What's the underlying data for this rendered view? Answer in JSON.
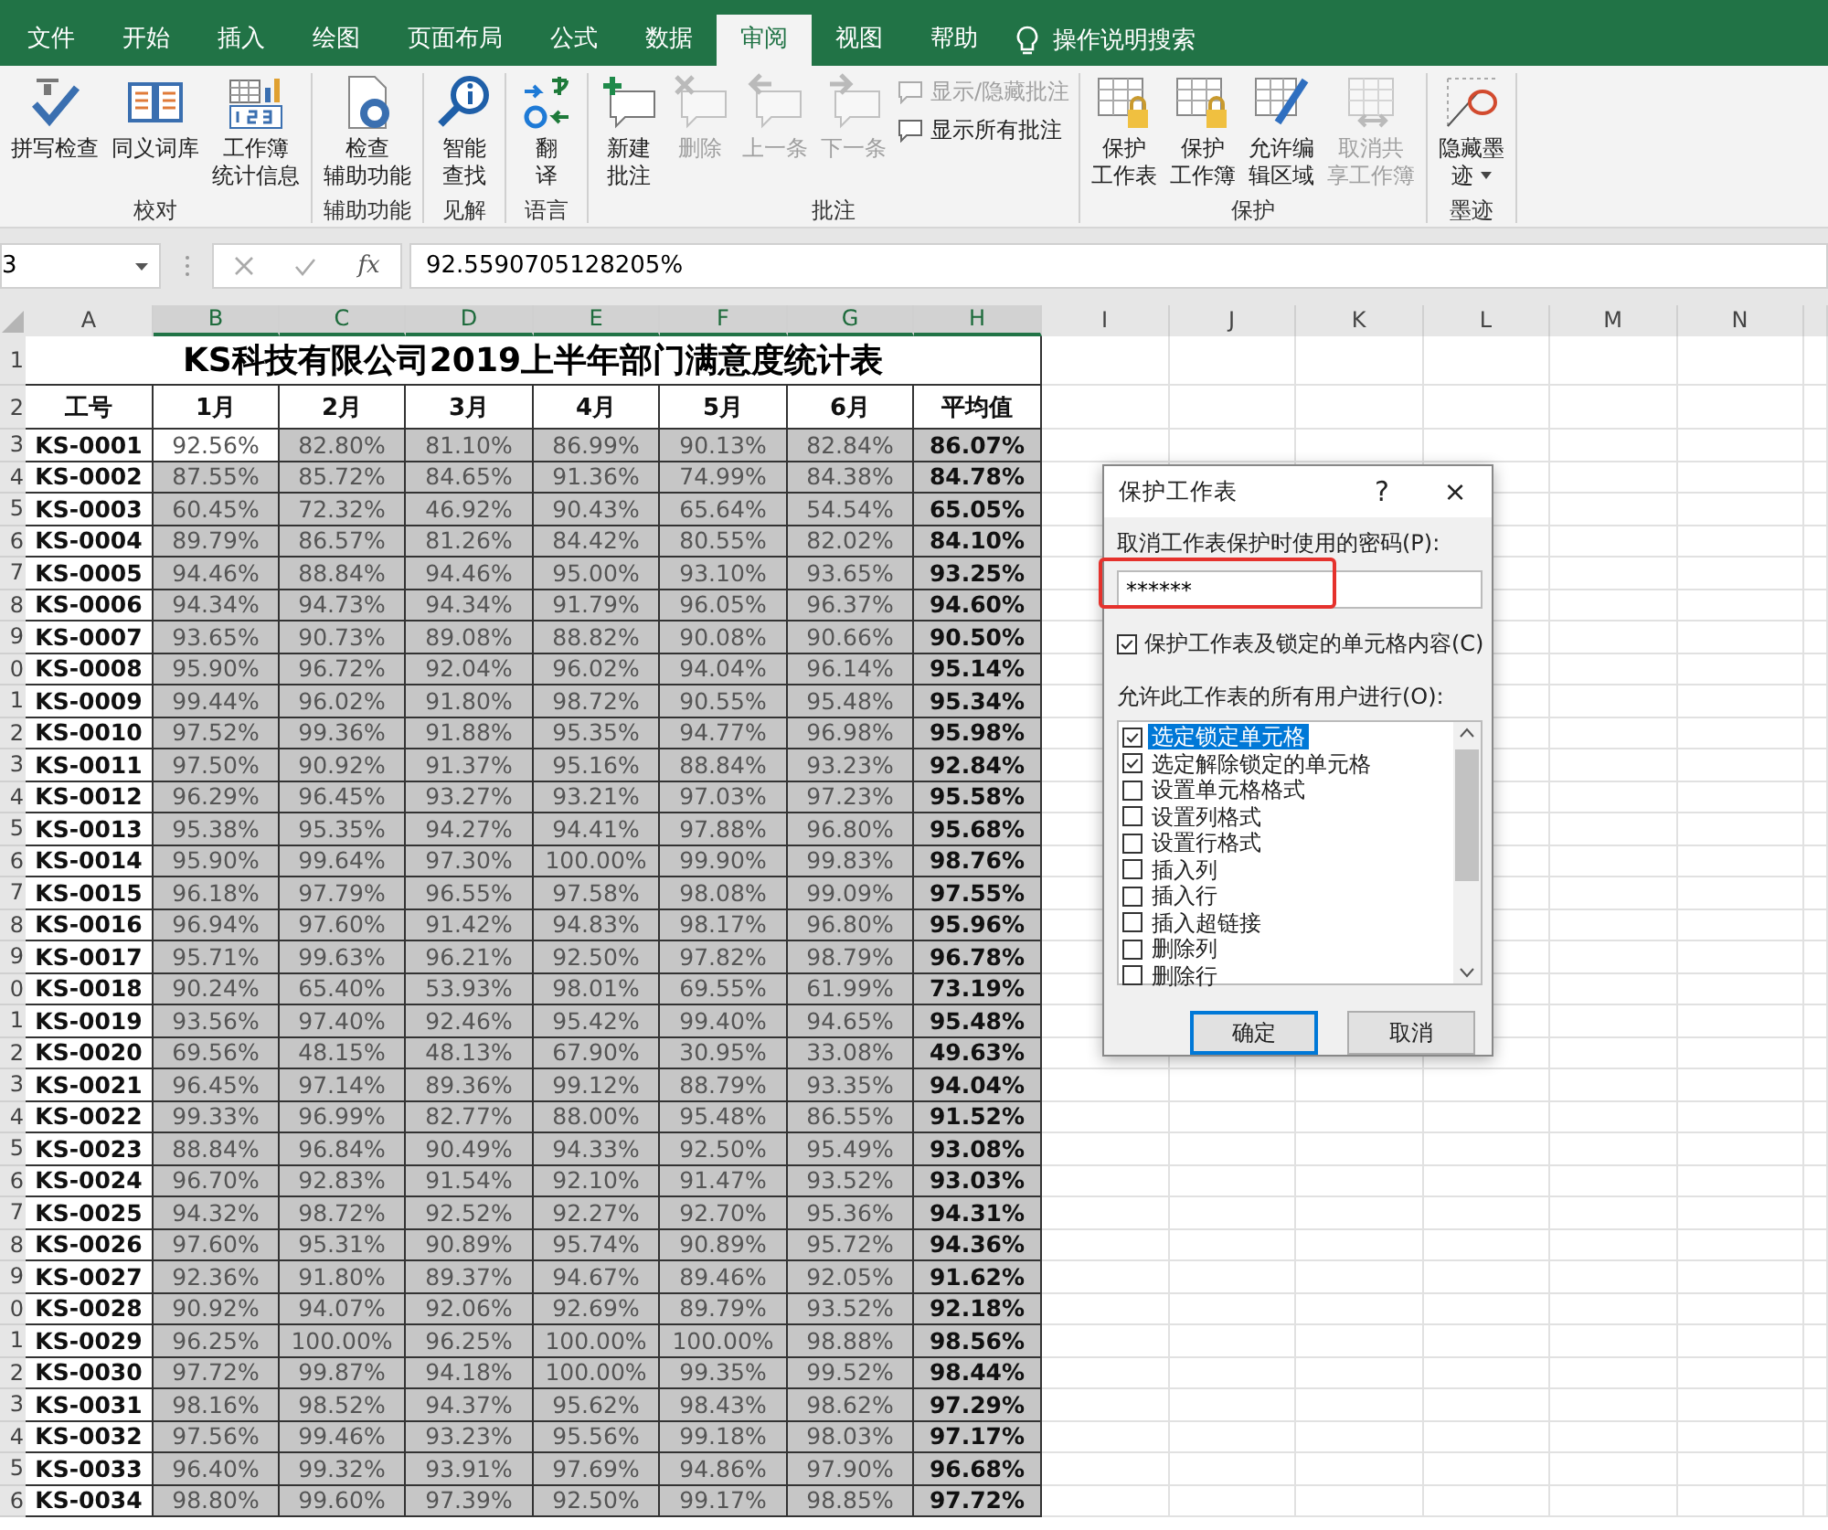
{
  "tabs": [
    {
      "label": "文件",
      "selected": false
    },
    {
      "label": "开始",
      "selected": false
    },
    {
      "label": "插入",
      "selected": false
    },
    {
      "label": "绘图",
      "selected": false
    },
    {
      "label": "页面布局",
      "selected": false
    },
    {
      "label": "公式",
      "selected": false
    },
    {
      "label": "数据",
      "selected": false
    },
    {
      "label": "审阅",
      "selected": true
    },
    {
      "label": "视图",
      "selected": false
    },
    {
      "label": "帮助",
      "selected": false
    }
  ],
  "search": {
    "label": "操作说明搜索"
  },
  "ribbon_groups": [
    {
      "label": "校对",
      "buttons": [
        {
          "lines": [
            "拼写检查"
          ],
          "disabled": false
        },
        {
          "lines": [
            "同义词库"
          ],
          "disabled": false
        },
        {
          "lines": [
            "工作簿",
            "统计信息"
          ],
          "disabled": false
        }
      ]
    },
    {
      "label": "辅助功能",
      "buttons": [
        {
          "lines": [
            "检查",
            "辅助功能"
          ],
          "disabled": false
        }
      ]
    },
    {
      "label": "见解",
      "buttons": [
        {
          "lines": [
            "智能",
            "查找"
          ],
          "disabled": false
        }
      ]
    },
    {
      "label": "语言",
      "buttons": [
        {
          "lines": [
            "翻",
            "译"
          ],
          "disabled": false
        }
      ]
    },
    {
      "label": "批注",
      "buttons": [
        {
          "lines": [
            "新建",
            "批注"
          ],
          "disabled": false
        },
        {
          "lines": [
            "删除"
          ],
          "disabled": true
        },
        {
          "lines": [
            "上一条"
          ],
          "disabled": true
        },
        {
          "lines": [
            "下一条"
          ],
          "disabled": true
        }
      ],
      "small_buttons": [
        {
          "label": "显示/隐藏批注",
          "disabled": true
        },
        {
          "label": "显示所有批注",
          "disabled": false
        }
      ]
    },
    {
      "label": "保护",
      "buttons": [
        {
          "lines": [
            "保护",
            "工作表"
          ],
          "disabled": false
        },
        {
          "lines": [
            "保护",
            "工作簿"
          ],
          "disabled": false
        },
        {
          "lines": [
            "允许编",
            "辑区域"
          ],
          "disabled": false
        },
        {
          "lines": [
            "取消共",
            "享工作簿"
          ],
          "disabled": true
        }
      ]
    },
    {
      "label": "墨迹",
      "buttons": [
        {
          "lines": [
            "隐藏墨",
            "迹"
          ],
          "disabled": false,
          "dropdown": true
        }
      ]
    }
  ],
  "formula_bar": {
    "name_box": "3",
    "function_label": "fx",
    "formula": "92.5590705128205%"
  },
  "sheet": {
    "columns": [
      {
        "label": "A",
        "selected": false
      },
      {
        "label": "B",
        "selected": true
      },
      {
        "label": "C",
        "selected": true
      },
      {
        "label": "D",
        "selected": true
      },
      {
        "label": "E",
        "selected": true
      },
      {
        "label": "F",
        "selected": true
      },
      {
        "label": "G",
        "selected": true
      },
      {
        "label": "H",
        "selected": true
      },
      {
        "label": "I",
        "selected": false
      },
      {
        "label": "J",
        "selected": false
      },
      {
        "label": "K",
        "selected": false
      },
      {
        "label": "L",
        "selected": false
      },
      {
        "label": "M",
        "selected": false
      },
      {
        "label": "N",
        "selected": false
      }
    ],
    "title_row": {
      "row": "1",
      "title": "KS科技有限公司2019上半年部门满意度统计表"
    },
    "header_row": {
      "row": "2",
      "cells": [
        "工号",
        "1月",
        "2月",
        "3月",
        "4月",
        "5月",
        "6月",
        "平均值"
      ]
    },
    "rows": [
      {
        "row": "3",
        "active": true,
        "cells": [
          "KS-0001",
          "92.56%",
          "82.80%",
          "81.10%",
          "86.99%",
          "90.13%",
          "82.84%",
          "86.07%"
        ]
      },
      {
        "row": "4",
        "active": false,
        "cells": [
          "KS-0002",
          "87.55%",
          "85.72%",
          "84.65%",
          "91.36%",
          "74.99%",
          "84.38%",
          "84.78%"
        ]
      },
      {
        "row": "5",
        "active": false,
        "cells": [
          "KS-0003",
          "60.45%",
          "72.32%",
          "46.92%",
          "90.43%",
          "65.64%",
          "54.54%",
          "65.05%"
        ]
      },
      {
        "row": "6",
        "active": false,
        "cells": [
          "KS-0004",
          "89.79%",
          "86.57%",
          "81.26%",
          "84.42%",
          "80.55%",
          "82.02%",
          "84.10%"
        ]
      },
      {
        "row": "7",
        "active": false,
        "cells": [
          "KS-0005",
          "94.46%",
          "88.84%",
          "94.46%",
          "95.00%",
          "93.10%",
          "93.65%",
          "93.25%"
        ]
      },
      {
        "row": "8",
        "active": false,
        "cells": [
          "KS-0006",
          "94.34%",
          "94.73%",
          "94.34%",
          "91.79%",
          "96.05%",
          "96.37%",
          "94.60%"
        ]
      },
      {
        "row": "9",
        "active": false,
        "cells": [
          "KS-0007",
          "93.65%",
          "90.73%",
          "89.08%",
          "88.82%",
          "90.08%",
          "90.66%",
          "90.50%"
        ]
      },
      {
        "row": "0",
        "active": false,
        "cells": [
          "KS-0008",
          "95.90%",
          "96.72%",
          "92.04%",
          "96.02%",
          "94.04%",
          "96.14%",
          "95.14%"
        ]
      },
      {
        "row": "1",
        "active": false,
        "cells": [
          "KS-0009",
          "99.44%",
          "96.02%",
          "91.80%",
          "98.72%",
          "90.55%",
          "95.48%",
          "95.34%"
        ]
      },
      {
        "row": "2",
        "active": false,
        "cells": [
          "KS-0010",
          "97.52%",
          "99.36%",
          "91.88%",
          "95.35%",
          "94.77%",
          "96.98%",
          "95.98%"
        ]
      },
      {
        "row": "3",
        "active": false,
        "cells": [
          "KS-0011",
          "97.50%",
          "90.92%",
          "91.37%",
          "95.16%",
          "88.84%",
          "93.23%",
          "92.84%"
        ]
      },
      {
        "row": "4",
        "active": false,
        "cells": [
          "KS-0012",
          "96.29%",
          "96.45%",
          "93.27%",
          "93.21%",
          "97.03%",
          "97.23%",
          "95.58%"
        ]
      },
      {
        "row": "5",
        "active": false,
        "cells": [
          "KS-0013",
          "95.38%",
          "95.35%",
          "94.27%",
          "94.41%",
          "97.88%",
          "96.80%",
          "95.68%"
        ]
      },
      {
        "row": "6",
        "active": false,
        "cells": [
          "KS-0014",
          "95.90%",
          "99.64%",
          "97.30%",
          "100.00%",
          "99.90%",
          "99.83%",
          "98.76%"
        ]
      },
      {
        "row": "7",
        "active": false,
        "cells": [
          "KS-0015",
          "96.18%",
          "97.79%",
          "96.55%",
          "97.58%",
          "98.08%",
          "99.09%",
          "97.55%"
        ]
      },
      {
        "row": "8",
        "active": false,
        "cells": [
          "KS-0016",
          "96.94%",
          "97.60%",
          "91.42%",
          "94.83%",
          "98.17%",
          "96.80%",
          "95.96%"
        ]
      },
      {
        "row": "9",
        "active": false,
        "cells": [
          "KS-0017",
          "95.71%",
          "99.63%",
          "96.21%",
          "92.50%",
          "97.82%",
          "98.79%",
          "96.78%"
        ]
      },
      {
        "row": "0",
        "active": false,
        "cells": [
          "KS-0018",
          "90.24%",
          "65.40%",
          "53.93%",
          "98.01%",
          "69.55%",
          "61.99%",
          "73.19%"
        ]
      },
      {
        "row": "1",
        "active": false,
        "cells": [
          "KS-0019",
          "93.56%",
          "97.40%",
          "92.46%",
          "95.42%",
          "99.40%",
          "94.65%",
          "95.48%"
        ]
      },
      {
        "row": "2",
        "active": false,
        "cells": [
          "KS-0020",
          "69.56%",
          "48.15%",
          "48.13%",
          "67.90%",
          "30.95%",
          "33.08%",
          "49.63%"
        ]
      },
      {
        "row": "3",
        "active": false,
        "cells": [
          "KS-0021",
          "96.45%",
          "97.14%",
          "89.36%",
          "99.12%",
          "88.79%",
          "93.35%",
          "94.04%"
        ]
      },
      {
        "row": "4",
        "active": false,
        "cells": [
          "KS-0022",
          "99.33%",
          "96.99%",
          "82.77%",
          "88.00%",
          "95.48%",
          "86.55%",
          "91.52%"
        ]
      },
      {
        "row": "5",
        "active": false,
        "cells": [
          "KS-0023",
          "88.84%",
          "96.84%",
          "90.49%",
          "94.33%",
          "92.50%",
          "95.49%",
          "93.08%"
        ]
      },
      {
        "row": "6",
        "active": false,
        "cells": [
          "KS-0024",
          "96.70%",
          "92.83%",
          "91.54%",
          "92.10%",
          "91.47%",
          "93.52%",
          "93.03%"
        ]
      },
      {
        "row": "7",
        "active": false,
        "cells": [
          "KS-0025",
          "94.32%",
          "98.72%",
          "92.52%",
          "92.27%",
          "92.70%",
          "95.36%",
          "94.31%"
        ]
      },
      {
        "row": "8",
        "active": false,
        "cells": [
          "KS-0026",
          "97.60%",
          "95.31%",
          "90.89%",
          "95.74%",
          "90.89%",
          "95.72%",
          "94.36%"
        ]
      },
      {
        "row": "9",
        "active": false,
        "cells": [
          "KS-0027",
          "92.36%",
          "91.80%",
          "89.37%",
          "94.67%",
          "89.46%",
          "92.05%",
          "91.62%"
        ]
      },
      {
        "row": "0",
        "active": false,
        "cells": [
          "KS-0028",
          "90.92%",
          "94.07%",
          "92.06%",
          "92.69%",
          "89.79%",
          "93.52%",
          "92.18%"
        ]
      },
      {
        "row": "1",
        "active": false,
        "cells": [
          "KS-0029",
          "96.25%",
          "100.00%",
          "96.25%",
          "100.00%",
          "100.00%",
          "98.88%",
          "98.56%"
        ]
      },
      {
        "row": "2",
        "active": false,
        "cells": [
          "KS-0030",
          "97.72%",
          "99.87%",
          "94.18%",
          "100.00%",
          "99.35%",
          "99.52%",
          "98.44%"
        ]
      },
      {
        "row": "3",
        "active": false,
        "cells": [
          "KS-0031",
          "98.16%",
          "98.52%",
          "94.37%",
          "95.62%",
          "98.43%",
          "98.62%",
          "97.29%"
        ]
      },
      {
        "row": "4",
        "active": false,
        "cells": [
          "KS-0032",
          "97.56%",
          "99.46%",
          "93.23%",
          "95.56%",
          "99.18%",
          "98.03%",
          "97.17%"
        ]
      },
      {
        "row": "5",
        "active": false,
        "cells": [
          "KS-0033",
          "96.40%",
          "99.32%",
          "93.91%",
          "97.69%",
          "94.86%",
          "97.90%",
          "96.68%"
        ]
      },
      {
        "row": "6",
        "active": false,
        "cells": [
          "KS-0034",
          "98.80%",
          "99.60%",
          "97.39%",
          "92.50%",
          "99.17%",
          "98.85%",
          "97.72%"
        ]
      }
    ]
  },
  "dialog": {
    "title": "保护工作表",
    "help": "?",
    "close": "×",
    "password_label": "取消工作表保护时使用的密码(P):",
    "password": {
      "value": "******",
      "highlighted": true
    },
    "protect_option": {
      "label": "保护工作表及锁定的单元格内容(C)",
      "checked": true
    },
    "list_label": "允许此工作表的所有用户进行(O):",
    "permissions": [
      {
        "label": "选定锁定单元格",
        "checked": true,
        "selected": true
      },
      {
        "label": "选定解除锁定的单元格",
        "checked": true,
        "selected": false
      },
      {
        "label": "设置单元格格式",
        "checked": false,
        "selected": false
      },
      {
        "label": "设置列格式",
        "checked": false,
        "selected": false
      },
      {
        "label": "设置行格式",
        "checked": false,
        "selected": false
      },
      {
        "label": "插入列",
        "checked": false,
        "selected": false
      },
      {
        "label": "插入行",
        "checked": false,
        "selected": false
      },
      {
        "label": "插入超链接",
        "checked": false,
        "selected": false
      },
      {
        "label": "删除列",
        "checked": false,
        "selected": false
      },
      {
        "label": "删除行",
        "checked": false,
        "selected": false
      }
    ],
    "buttons": [
      {
        "label": "确定",
        "default": true
      },
      {
        "label": "取消",
        "default": false
      }
    ]
  }
}
